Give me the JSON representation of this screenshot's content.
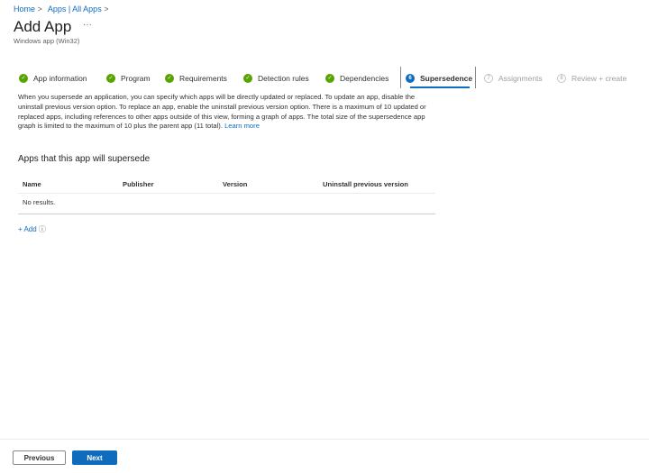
{
  "breadcrumb": {
    "items": [
      "Home",
      "Apps | All Apps"
    ],
    "separator": ">"
  },
  "header": {
    "title": "Add App",
    "more": "···",
    "subtitle": "Windows app (Win32)"
  },
  "steps": [
    {
      "label": "App information",
      "state": "done",
      "icon": "✓"
    },
    {
      "label": "Program",
      "state": "done",
      "icon": "✓"
    },
    {
      "label": "Requirements",
      "state": "done",
      "icon": "✓"
    },
    {
      "label": "Detection rules",
      "state": "done",
      "icon": "✓"
    },
    {
      "label": "Dependencies",
      "state": "done",
      "icon": "✓"
    },
    {
      "label": "Supersedence",
      "state": "current",
      "icon": "6"
    },
    {
      "label": "Assignments",
      "state": "pending",
      "icon": "7"
    },
    {
      "label": "Review + create",
      "state": "pending",
      "icon": "8"
    }
  ],
  "description": {
    "text": "When you supersede an application, you can specify which apps will be directly updated or replaced. To update an app, disable the uninstall previous version option. To replace an app, enable the uninstall previous version option. There is a maximum of 10 updated or replaced apps, including references to other apps outside of this view, forming a graph of apps. The total size of the supersedence app graph is limited to the maximum of 10 plus the parent app (11 total).",
    "link": "Learn more"
  },
  "section": {
    "title": "Apps that this app will supersede",
    "columns": [
      "Name",
      "Publisher",
      "Version",
      "Uninstall previous version"
    ],
    "empty": "No results.",
    "add": "+ Add",
    "info_icon": "ⓘ"
  },
  "footer": {
    "previous": "Previous",
    "next": "Next"
  }
}
